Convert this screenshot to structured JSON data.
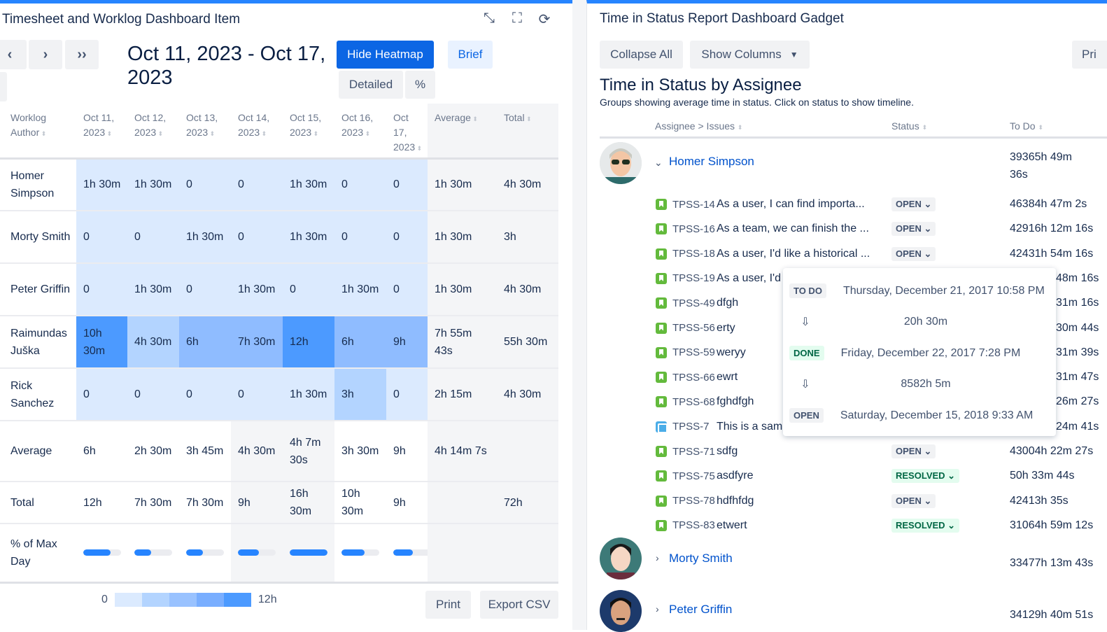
{
  "left": {
    "title": "Timesheet and Worklog Dashboard Item",
    "nav": [
      "‹",
      "›",
      "››"
    ],
    "date_range": "Oct 11, 2023 - Oct 17, 2023",
    "buttons": {
      "heatmap": "Hide Heatmap",
      "brief": "Brief",
      "detailed": "Detailed",
      "percent": "%"
    },
    "columns": [
      "Worklog Author",
      "Oct 11, 2023",
      "Oct 12, 2023",
      "Oct 13, 2023",
      "Oct 14, 2023",
      "Oct 15, 2023",
      "Oct 16, 2023",
      "Oct 17, 2023",
      "Average",
      "Total"
    ],
    "rows": [
      {
        "author": "Homer Simpson",
        "days": [
          "1h 30m",
          "1h 30m",
          "0",
          "0",
          "1h 30m",
          "0",
          "0"
        ],
        "average": "1h 30m",
        "total": "4h 30m"
      },
      {
        "author": "Morty Smith",
        "days": [
          "0",
          "0",
          "1h 30m",
          "0",
          "1h 30m",
          "0",
          "0"
        ],
        "average": "1h 30m",
        "total": "3h"
      },
      {
        "author": "Peter Griffin",
        "days": [
          "0",
          "1h 30m",
          "0",
          "1h 30m",
          "0",
          "1h 30m",
          "0"
        ],
        "average": "1h 30m",
        "total": "4h 30m"
      },
      {
        "author": "Raimundas Juška",
        "days": [
          "10h 30m",
          "4h 30m",
          "6h",
          "7h 30m",
          "12h",
          "6h",
          "9h"
        ],
        "average": "7h 55m 43s",
        "total": "55h 30m"
      },
      {
        "author": "Rick Sanchez",
        "days": [
          "0",
          "0",
          "0",
          "0",
          "1h 30m",
          "3h",
          "0"
        ],
        "average": "2h 15m",
        "total": "4h 30m"
      }
    ],
    "average_row": {
      "label": "Average",
      "days": [
        "6h",
        "2h 30m",
        "3h 45m",
        "4h 30m",
        "4h 7m 30s",
        "3h 30m",
        "9h"
      ],
      "average": "4h 14m 7s"
    },
    "total_row": {
      "label": "Total",
      "days": [
        "12h",
        "7h 30m",
        "7h 30m",
        "9h",
        "16h 30m",
        "10h 30m",
        "9h"
      ],
      "total": "72h"
    },
    "percent_row": {
      "label": "% of Max Day",
      "percents": [
        72,
        45,
        45,
        55,
        100,
        62,
        52
      ]
    },
    "legend": {
      "min": "0",
      "max": "12h",
      "colors": [
        "#dbeafe",
        "#b3d4ff",
        "#99c2ff",
        "#79aeff",
        "#4c9aff"
      ]
    },
    "print": "Print",
    "export": "Export CSV"
  },
  "right": {
    "title": "Time in Status Report Dashboard Gadget",
    "collapse_all": "Collapse All",
    "show_columns": "Show Columns",
    "print_partial": "Pri",
    "heading": "Time in Status by Assignee",
    "subtitle": "Groups showing average time in status. Click on status to show timeline.",
    "headers": {
      "assignee": "Assignee > Issues",
      "status": "Status",
      "todo": "To Do"
    },
    "assignees": [
      {
        "name": "Homer Simpson",
        "todo": "39365h 49m 36s"
      },
      {
        "name": "Morty Smith",
        "todo": "33477h 13m 43s"
      },
      {
        "name": "Peter Griffin",
        "todo": "34129h 40m 51s"
      }
    ],
    "issues": [
      {
        "key": "TPSS-14",
        "summary": "As a user, I can find importa...",
        "status": "OPEN",
        "todo": "46384h 47m 2s"
      },
      {
        "key": "TPSS-16",
        "summary": "As a team, we can finish the ...",
        "status": "OPEN",
        "todo": "42916h 12m 16s"
      },
      {
        "key": "TPSS-18",
        "summary": "As a user, I'd like a historical ...",
        "status": "OPEN",
        "todo": "42431h 54m 16s"
      },
      {
        "key": "TPSS-19",
        "summary": "As a user, I'd",
        "todo": "48m 16s"
      },
      {
        "key": "TPSS-49",
        "summary": "dfgh",
        "todo": "31m 16s"
      },
      {
        "key": "TPSS-56",
        "summary": "erty",
        "todo": "30m 44s"
      },
      {
        "key": "TPSS-59",
        "summary": "weryy",
        "todo": "31m 39s"
      },
      {
        "key": "TPSS-66",
        "summary": "ewrt",
        "todo": "31m 47s"
      },
      {
        "key": "TPSS-68",
        "summary": "fghdfgh",
        "todo": "26m 27s"
      },
      {
        "key": "TPSS-7",
        "summary": "This is a samp",
        "todo": "24m 41s",
        "type": "subtask"
      },
      {
        "key": "TPSS-71",
        "summary": "sdfg",
        "status": "OPEN",
        "todo": "43004h 22m 27s"
      },
      {
        "key": "TPSS-75",
        "summary": "asdfyre",
        "status": "RESOLVED",
        "todo": "50h 33m 44s"
      },
      {
        "key": "TPSS-78",
        "summary": "hdfhfdg",
        "status": "OPEN",
        "todo": "42413h 35s"
      },
      {
        "key": "TPSS-83",
        "summary": "etwert",
        "status": "RESOLVED",
        "todo": "31064h 59m 12s"
      }
    ],
    "popup": {
      "entries": [
        {
          "status": "TO DO",
          "date": "Thursday, December 21, 2017 10:58 PM"
        },
        {
          "duration": "20h 30m"
        },
        {
          "status": "DONE",
          "date": "Friday, December 22, 2017 7:28 PM"
        },
        {
          "duration": "8582h 5m"
        },
        {
          "status": "OPEN",
          "date": "Saturday, December 15, 2018 9:33 AM"
        }
      ]
    }
  }
}
